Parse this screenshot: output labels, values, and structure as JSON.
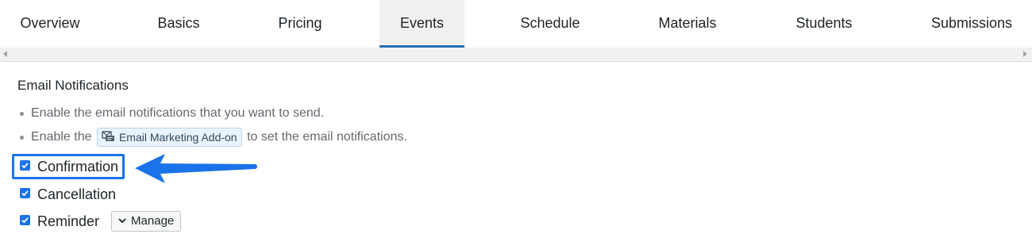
{
  "tabs": [
    {
      "label": "Overview",
      "active": false
    },
    {
      "label": "Basics",
      "active": false
    },
    {
      "label": "Pricing",
      "active": false
    },
    {
      "label": "Events",
      "active": true
    },
    {
      "label": "Schedule",
      "active": false
    },
    {
      "label": "Materials",
      "active": false
    },
    {
      "label": "Students",
      "active": false
    },
    {
      "label": "Submissions",
      "active": false
    }
  ],
  "section": {
    "title": "Email Notifications",
    "note_1": "Enable the email notifications that you want to send.",
    "note_2_prefix": "Enable the",
    "addon_label": "Email Marketing Add-on",
    "addon_icon": "email-marketing-icon",
    "note_2_suffix": "to set the email notifications."
  },
  "options": [
    {
      "label": "Confirmation",
      "checked": true,
      "highlighted": true
    },
    {
      "label": "Cancellation",
      "checked": true
    },
    {
      "label": "Reminder",
      "checked": true
    }
  ],
  "manage_button": {
    "label": "Manage",
    "icon": "chevron-down-icon"
  },
  "colors": {
    "accent": "#1a73e8",
    "active_tab_bg": "#f0f0f1",
    "active_tab_underline": "#2271b1",
    "muted_text": "#646970"
  }
}
